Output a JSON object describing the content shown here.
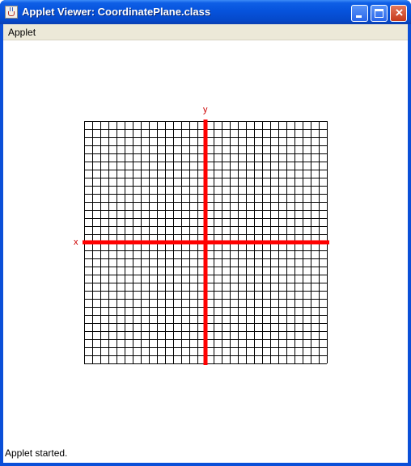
{
  "window": {
    "title": "Applet Viewer: CoordinatePlane.class",
    "icon": "java-coffee-cup-icon",
    "controls": [
      "minimize-icon",
      "maximize-icon",
      "close-icon"
    ]
  },
  "menubar": {
    "items": [
      {
        "label": "Applet"
      }
    ]
  },
  "plane": {
    "x_label": "x",
    "y_label": "y",
    "grid_cells": 30,
    "axis_color": "#ff0000",
    "grid_color": "#000000",
    "label_color": "#cc0000"
  },
  "status": {
    "text": "Applet started."
  }
}
